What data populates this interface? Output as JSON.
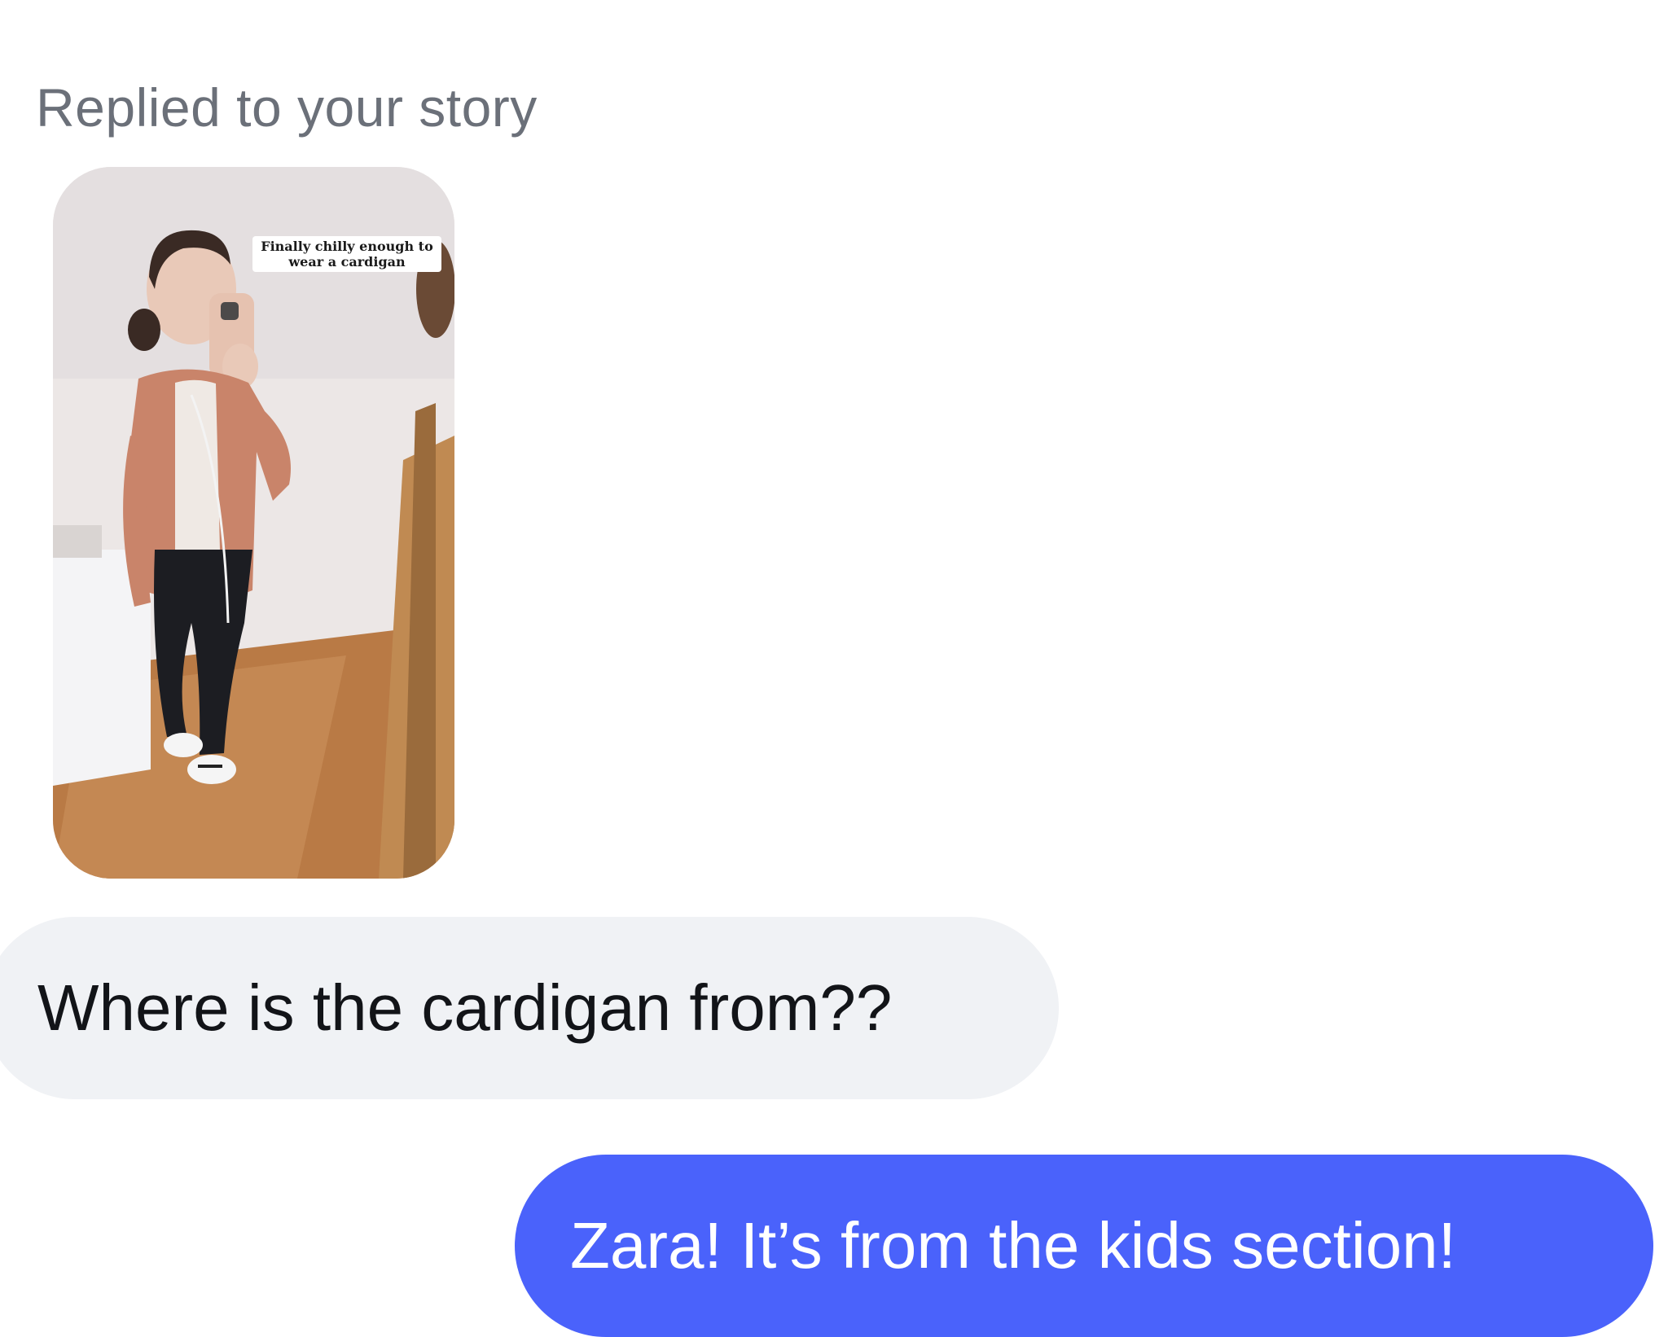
{
  "conversation": {
    "reply_header": "Replied to your story",
    "story": {
      "caption": "Finally chilly enough to wear a cardigan",
      "image_icon": "story-photo-image"
    },
    "messages": [
      {
        "direction": "incoming",
        "text": "Where is the cardigan from??"
      },
      {
        "direction": "outgoing",
        "text": "Zara! It’s from the kids section!"
      }
    ]
  },
  "colors": {
    "incoming_bubble": "#f0f2f5",
    "outgoing_bubble": "#4a62fb",
    "header_text": "#6b7079"
  }
}
